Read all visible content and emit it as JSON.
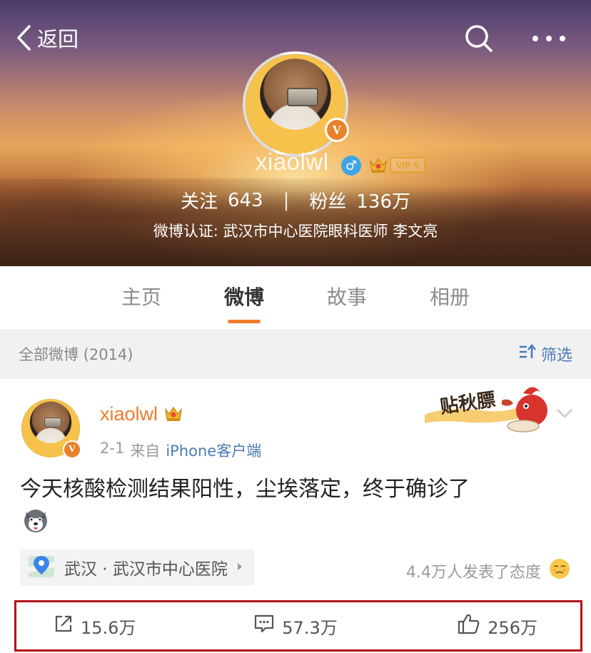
{
  "header": {
    "back_label": "返回",
    "username": "xiaolwl",
    "vip_label": "VIP 5",
    "following_label": "关注",
    "following_count": "643",
    "separator": "|",
    "followers_label": "粉丝",
    "followers_count": "136万",
    "verification": "微博认证: 武汉市中心医院眼科医师 李文亮",
    "verified_badge": "V"
  },
  "tabs": [
    {
      "label": "主页",
      "active": false
    },
    {
      "label": "微博",
      "active": true
    },
    {
      "label": "故事",
      "active": false
    },
    {
      "label": "相册",
      "active": false
    }
  ],
  "filter_bar": {
    "all_posts": "全部微博 (2014)",
    "filter_label": "筛选"
  },
  "post": {
    "username": "xiaolwl",
    "date": "2-1",
    "source_prefix": "来自",
    "source": "iPhone客户端",
    "text": "今天核酸检测结果阳性，尘埃落定，终于确诊了",
    "verified_badge": "V",
    "sticker_text": "贴秋膘",
    "location": "武汉 · 武汉市中心医院",
    "attitude": "4.4万人发表了态度",
    "actions": {
      "repost": "15.6万",
      "comment": "57.3万",
      "like": "256万"
    }
  },
  "colors": {
    "accent_orange": "#f07b2a",
    "link_blue": "#4a7bb7",
    "highlight_red": "#b3121a",
    "verified_orange": "#e8822b"
  },
  "icons": [
    "back-chevron-icon",
    "search-icon",
    "more-icon",
    "male-icon",
    "vip-crown-icon",
    "filter-icon",
    "location-pin-icon",
    "dog-emoji-icon",
    "attitude-emoji-icon",
    "repost-icon",
    "comment-icon",
    "like-icon",
    "chevron-down-icon"
  ]
}
